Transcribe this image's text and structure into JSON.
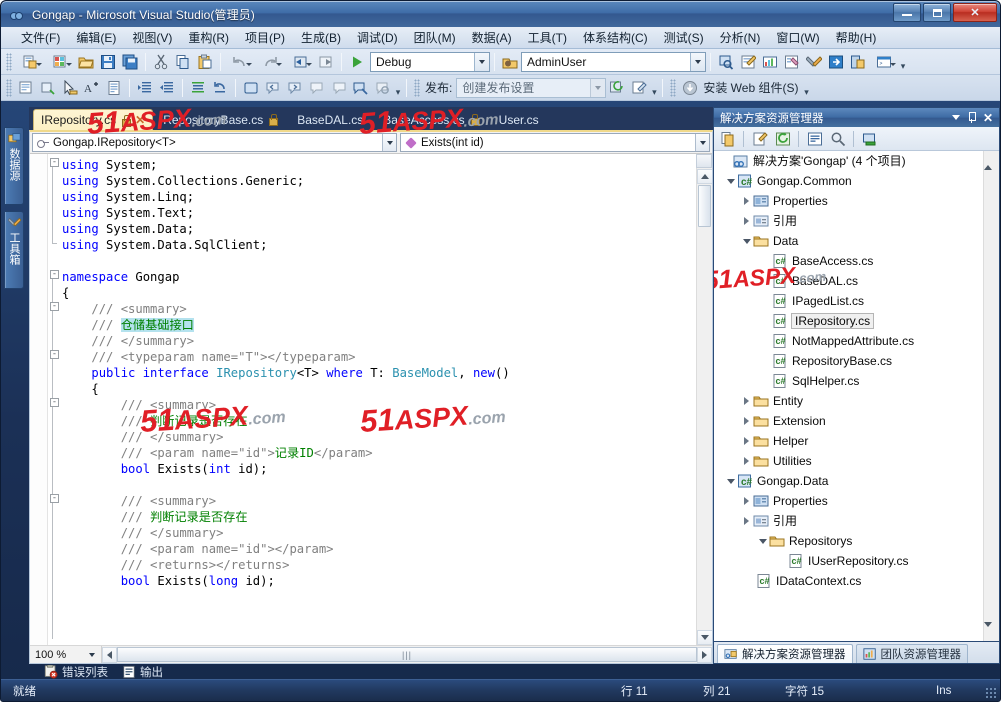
{
  "window": {
    "title": "Gongap - Microsoft Visual Studio(管理员)",
    "minimize_label": "–",
    "maximize_label": "□",
    "close_label": "✕"
  },
  "menubar": {
    "items": [
      {
        "label": "文件(F)"
      },
      {
        "label": "编辑(E)"
      },
      {
        "label": "视图(V)"
      },
      {
        "label": "重构(R)"
      },
      {
        "label": "项目(P)"
      },
      {
        "label": "生成(B)"
      },
      {
        "label": "调试(D)"
      },
      {
        "label": "团队(M)"
      },
      {
        "label": "数据(A)"
      },
      {
        "label": "工具(T)"
      },
      {
        "label": "体系结构(C)"
      },
      {
        "label": "测试(S)"
      },
      {
        "label": "分析(N)"
      },
      {
        "label": "窗口(W)"
      },
      {
        "label": "帮助(H)"
      }
    ]
  },
  "toolbar_main": {
    "icons": [
      "new-project-icon",
      "new-item-icon",
      "open-file-icon",
      "save-icon",
      "save-all-icon",
      "cut-icon",
      "copy-icon",
      "paste-icon",
      "undo-icon",
      "redo-icon",
      "navigate-back-icon",
      "navigate-forward-icon"
    ],
    "start_debug_label": "▶",
    "config_combo": {
      "value": "Debug",
      "name": "solution-configuration"
    },
    "target_combo": {
      "value": "AdminUser",
      "name": "startup-project"
    },
    "right_icons": [
      "find-in-files-icon",
      "toolbox-icon",
      "properties-window-icon",
      "object-browser-icon",
      "tools-icon",
      "go-to-icon",
      "solution-explorer-icon",
      "command-window-icon"
    ]
  },
  "toolbar_second": {
    "icons": [
      "comment-icon",
      "uncomment-icon",
      "select-icon",
      "font-icon",
      "format-icon",
      "indent-icon",
      "outdent-icon",
      "align-icon",
      "undo-layout-icon",
      "rect-icon",
      "bookmark1-icon",
      "bookmark2-icon",
      "bookmark3-icon",
      "bookmark4-icon",
      "bookmark5-icon",
      "bookmark6-icon",
      "search-tag-icon"
    ],
    "publish_label": "发布:",
    "publish_combo": {
      "value": "创建发布设置"
    },
    "publish_icons": [
      "publish-refresh-icon",
      "publish-edit-icon"
    ],
    "web_components_label": "安装 Web 组件(S)"
  },
  "left_rail": {
    "tabs": [
      {
        "label": "数据源",
        "icon": "data-sources-icon"
      },
      {
        "label": "工具箱",
        "icon": "toolbox-icon"
      }
    ]
  },
  "editor": {
    "tabs": [
      {
        "label": "IRepository.cs",
        "active": true,
        "locked": true,
        "closable": true
      },
      {
        "label": "RepositoryBase.cs",
        "active": false,
        "locked": true,
        "closable": false
      },
      {
        "label": "BaseDAL.cs",
        "active": false,
        "locked": false,
        "closable": false
      },
      {
        "label": "BaseAccess.cs",
        "active": false,
        "locked": true,
        "closable": false
      },
      {
        "label": "User.cs",
        "active": false,
        "locked": false,
        "closable": false
      }
    ],
    "nav_type": "Gongap.IRepository<T>",
    "nav_member": "Exists(int id)",
    "zoom": "100 %",
    "code_lines": [
      "using System;",
      "using System.Collections.Generic;",
      "using System.Linq;",
      "using System.Text;",
      "using System.Data;",
      "using System.Data.SqlClient;",
      "",
      "namespace Gongap",
      "{",
      "    /// <summary>",
      "    /// 仓储基础接口",
      "    /// </summary>",
      "    /// <typeparam name=\"T\"></typeparam>",
      "    public interface IRepository<T> where T: BaseModel, new()",
      "    {",
      "        /// <summary>",
      "        /// 判断记录是否存在",
      "        /// </summary>",
      "        /// <param name=\"id\">记录ID</param>",
      "        bool Exists(int id);",
      "",
      "        /// <summary>",
      "        /// 判断记录是否存在",
      "        /// </summary>",
      "        /// <param name=\"id\"></param>",
      "        /// <returns></returns>",
      "        bool Exists(long id);"
    ],
    "highlighted_text": "仓储基础接口"
  },
  "solution_explorer": {
    "title": "解决方案资源管理器",
    "toolbar_icons": [
      "properties-icon",
      "show-all-files-icon",
      "refresh-icon",
      "view-code-icon",
      "view-designer-icon",
      "show-output-icon"
    ],
    "tree": [
      {
        "depth": 0,
        "label": "解决方案'Gongap' (4 个项目)",
        "icon": "solution-icon",
        "expander": "none"
      },
      {
        "depth": 1,
        "label": "Gongap.Common",
        "icon": "csharp-project-icon",
        "expander": "open"
      },
      {
        "depth": 2,
        "label": "Properties",
        "icon": "properties-folder-icon",
        "expander": "closed"
      },
      {
        "depth": 2,
        "label": "引用",
        "icon": "references-icon",
        "expander": "closed"
      },
      {
        "depth": 2,
        "label": "Data",
        "icon": "folder-icon",
        "expander": "open"
      },
      {
        "depth": 3,
        "label": "BaseAccess.cs",
        "icon": "csharp-file-icon",
        "expander": "none"
      },
      {
        "depth": 3,
        "label": "BaseDAL.cs",
        "icon": "csharp-file-icon",
        "expander": "none"
      },
      {
        "depth": 3,
        "label": "IPagedList.cs",
        "icon": "csharp-file-icon",
        "expander": "none"
      },
      {
        "depth": 3,
        "label": "IRepository.cs",
        "icon": "csharp-file-icon",
        "expander": "none",
        "selected": true
      },
      {
        "depth": 3,
        "label": "NotMappedAttribute.cs",
        "icon": "csharp-file-icon",
        "expander": "none"
      },
      {
        "depth": 3,
        "label": "RepositoryBase.cs",
        "icon": "csharp-file-icon",
        "expander": "none"
      },
      {
        "depth": 3,
        "label": "SqlHelper.cs",
        "icon": "csharp-file-icon",
        "expander": "none"
      },
      {
        "depth": 2,
        "label": "Entity",
        "icon": "folder-icon",
        "expander": "closed"
      },
      {
        "depth": 2,
        "label": "Extension",
        "icon": "folder-icon",
        "expander": "closed"
      },
      {
        "depth": 2,
        "label": "Helper",
        "icon": "folder-icon",
        "expander": "closed"
      },
      {
        "depth": 2,
        "label": "Utilities",
        "icon": "folder-icon",
        "expander": "closed"
      },
      {
        "depth": 1,
        "label": "Gongap.Data",
        "icon": "csharp-project-icon",
        "expander": "open"
      },
      {
        "depth": 2,
        "label": "Properties",
        "icon": "properties-folder-icon",
        "expander": "closed"
      },
      {
        "depth": 2,
        "label": "引用",
        "icon": "references-icon",
        "expander": "closed"
      },
      {
        "depth": 2,
        "label": "Repositorys",
        "icon": "folder-icon",
        "expander": "open"
      },
      {
        "depth": 3,
        "label": "IUserRepository.cs",
        "icon": "csharp-file-icon",
        "expander": "none"
      },
      {
        "depth": 2,
        "label": "IDataContext.cs",
        "icon": "csharp-file-icon",
        "expander": "none"
      }
    ],
    "panel_tabs": [
      {
        "label": "解决方案资源管理器",
        "icon": "solution-explorer-icon",
        "active": true
      },
      {
        "label": "团队资源管理器",
        "icon": "team-explorer-icon",
        "active": false
      }
    ]
  },
  "bottom_tabs": [
    {
      "label": "错误列表",
      "icon": "error-list-icon"
    },
    {
      "label": "输出",
      "icon": "output-icon"
    }
  ],
  "statusbar": {
    "ready": "就绪",
    "line": "行 11",
    "column": "列 21",
    "character": "字符 15",
    "insert_mode": "Ins"
  },
  "watermark": {
    "red": "51",
    "italic": "ASPX",
    "suffix": ".com"
  }
}
